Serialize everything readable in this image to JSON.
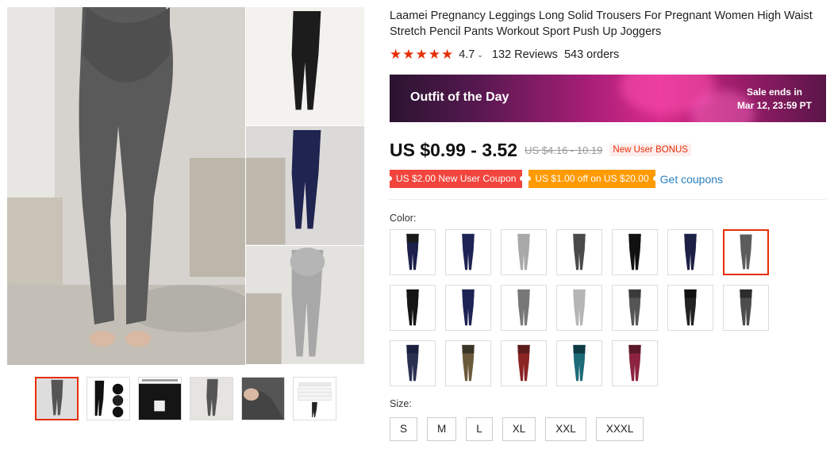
{
  "product": {
    "title": "Laamei Pregnancy Leggings Long Solid Trousers For Pregnant Women High Waist Stretch Pencil Pants Workout Sport Push Up Joggers",
    "stars": "★★★★★",
    "rating": "4.7",
    "reviews": "132 Reviews",
    "orders": "543 orders"
  },
  "banner": {
    "title": "Outfit of the Day",
    "sale_line1": "Sale ends in",
    "sale_line2": "Mar 12, 23:59 PT"
  },
  "pricing": {
    "price": "US $0.99 - 3.52",
    "old_price": "US $4.16 - 10.19",
    "bonus": "New User BONUS"
  },
  "coupons": {
    "new_user": "US $2.00 New User Coupon",
    "off": "US $1.00 off on US $20.00",
    "get": "Get coupons"
  },
  "color_label": "Color:",
  "size_label": "Size:",
  "sizes": [
    "S",
    "M",
    "L",
    "XL",
    "XXL",
    "XXXL"
  ],
  "gallery_colors": {
    "main": "#5a5a5a",
    "side": [
      "#1c1c1c",
      "#1f2450",
      "#a8a8a8"
    ],
    "thumbs": [
      "#555555",
      "#111111",
      "#111111",
      "#555555",
      "#555555",
      "#cccccc"
    ]
  },
  "swatch_colors": [
    [
      "#1a1a1a",
      "#1b1f4a"
    ],
    [
      "#1d2352",
      "#1d2352"
    ],
    [
      "#a9a9a9",
      "#a9a9a9"
    ],
    [
      "#4a4a4a",
      "#4a4a4a"
    ],
    [
      "#111111",
      "#111111"
    ],
    [
      "#1c2045",
      "#1c2045"
    ],
    [
      "#5c5c5c",
      "#5c5c5c"
    ],
    [
      "#151515",
      "#151515"
    ],
    [
      "#1d2352",
      "#1d2352"
    ],
    [
      "#777777",
      "#777777"
    ],
    [
      "#b5b5b5",
      "#b5b5b5"
    ],
    [
      "#3a3a3a",
      "#555555"
    ],
    [
      "#111111",
      "#222222"
    ],
    [
      "#2c2c2c",
      "#4d4d4d"
    ],
    [
      "#1c2040",
      "#2a3050"
    ],
    [
      "#3b3527",
      "#6b5a3a"
    ],
    [
      "#5c1c1c",
      "#8c2424"
    ],
    [
      "#0e3a44",
      "#1d6a78"
    ],
    [
      "#5a1828",
      "#8c2440"
    ]
  ],
  "active_swatch": 6
}
